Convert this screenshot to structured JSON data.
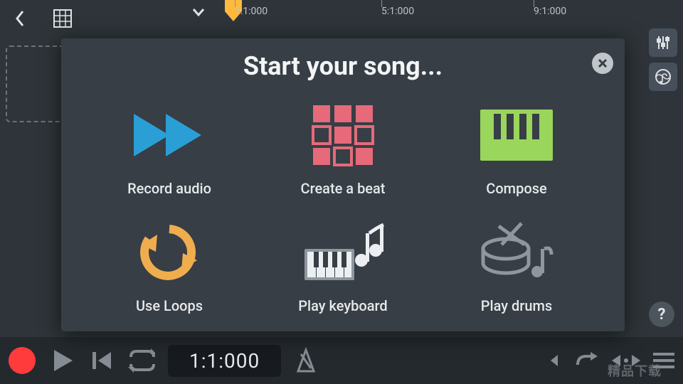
{
  "topbar": {
    "back": "back",
    "grid": "grid-view",
    "dropdown": "dropdown"
  },
  "ruler": {
    "marks": [
      "1:1:000",
      "5:1:000",
      "9:1:000"
    ]
  },
  "side": {
    "mixer": "mixer",
    "browse": "browse"
  },
  "help": {
    "label": "?"
  },
  "transport": {
    "record": "record",
    "play": "play",
    "prev": "skip-start",
    "loop": "loop",
    "time": "1:1:000",
    "metronome": "metronome",
    "undo_left": "undo-left",
    "redo": "redo",
    "fit": "fit-horizontal",
    "menu": "menu"
  },
  "modal": {
    "title": "Start your song...",
    "close": "close",
    "options": [
      {
        "key": "record",
        "label": "Record audio"
      },
      {
        "key": "beat",
        "label": "Create a beat"
      },
      {
        "key": "compose",
        "label": "Compose"
      },
      {
        "key": "loops",
        "label": "Use Loops"
      },
      {
        "key": "keyboard",
        "label": "Play keyboard"
      },
      {
        "key": "drums",
        "label": "Play drums"
      }
    ]
  },
  "watermark": "精品下载"
}
